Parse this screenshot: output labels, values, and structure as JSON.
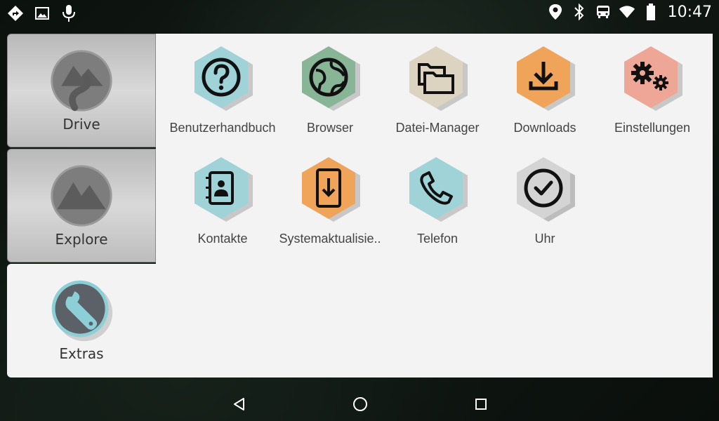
{
  "status_bar": {
    "time": "10:47",
    "left_icons": [
      "navigation-icon",
      "image-icon",
      "microphone-icon"
    ],
    "right_icons": [
      "location-icon",
      "bluetooth-icon",
      "bus-icon",
      "wifi-icon",
      "battery-icon"
    ]
  },
  "side_tabs": [
    {
      "label": "Drive",
      "icon": "road-icon",
      "active": false
    },
    {
      "label": "Explore",
      "icon": "mountain-icon",
      "active": false
    },
    {
      "label": "Extras",
      "icon": "wrench-icon",
      "active": true
    }
  ],
  "apps": [
    {
      "label": "Benutzerhandbuch",
      "icon": "help-icon",
      "color": "#9fd3d8"
    },
    {
      "label": "Browser",
      "icon": "globe-icon",
      "color": "#88b596"
    },
    {
      "label": "Datei-Manager",
      "icon": "folders-icon",
      "color": "#dcd4c0"
    },
    {
      "label": "Downloads",
      "icon": "download-icon",
      "color": "#f0a45a"
    },
    {
      "label": "Einstellungen",
      "icon": "gears-icon",
      "color": "#eea696"
    },
    {
      "label": "Kontakte",
      "icon": "contacts-icon",
      "color": "#9fd3d8"
    },
    {
      "label": "Systemaktualisie..",
      "icon": "system-update-icon",
      "color": "#f0a45a"
    },
    {
      "label": "Telefon",
      "icon": "phone-icon",
      "color": "#9fd3d8"
    },
    {
      "label": "Uhr",
      "icon": "clock-icon",
      "color": "#d4d4d4"
    }
  ],
  "nav_bar": {
    "buttons": [
      "back-icon",
      "home-icon",
      "recents-icon"
    ]
  }
}
